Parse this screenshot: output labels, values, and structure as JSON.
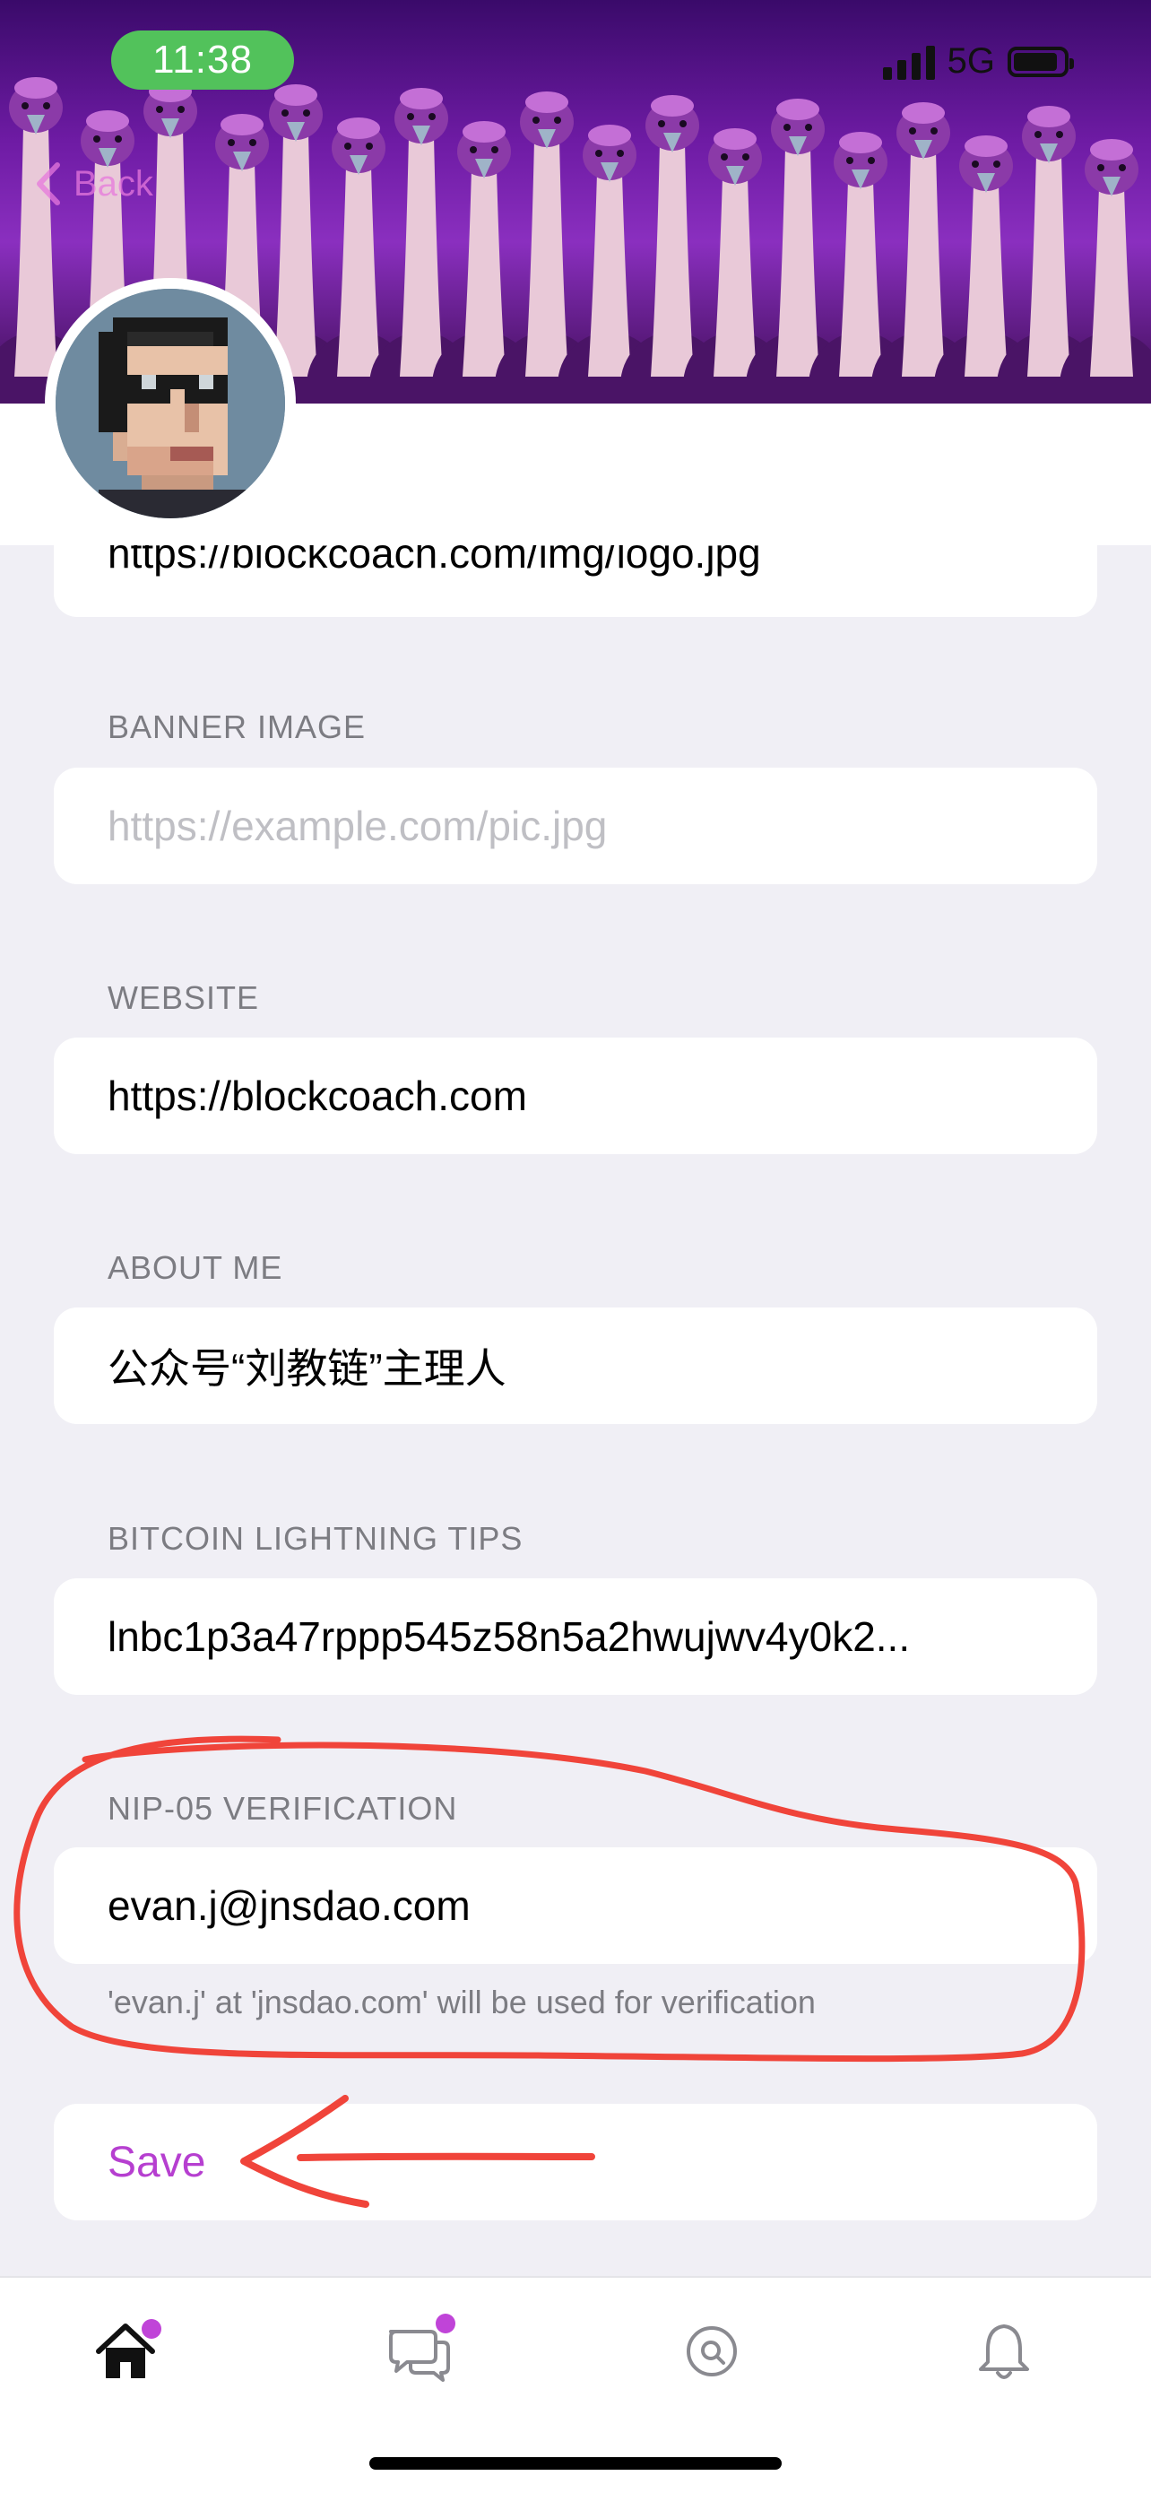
{
  "status_bar": {
    "time": "11:38",
    "network": "5G",
    "battery_level": 0.8
  },
  "nav": {
    "back_label": "Back"
  },
  "fields": {
    "picture_value": "https://blockcoach.com/img/logo.jpg",
    "banner": {
      "label": "BANNER IMAGE",
      "placeholder": "https://example.com/pic.jpg"
    },
    "website": {
      "label": "WEBSITE",
      "value": "https://blockcoach.com"
    },
    "about": {
      "label": "ABOUT ME",
      "value": " 公众号“刘教链”主理人"
    },
    "lightning": {
      "label": "BITCOIN LIGHTNING TIPS",
      "value": "lnbc1p3a47rppp545z58n5a2hwujwv4y0k2..."
    },
    "nip05": {
      "label": "NIP-05 VERIFICATION",
      "value": "evan.j@jnsdao.com",
      "helper": "'evan.j' at 'jnsdao.com' will be used for verification"
    }
  },
  "actions": {
    "save_label": "Save"
  },
  "tabbar": {
    "items": [
      {
        "name": "home",
        "icon": "home-icon",
        "badge": true
      },
      {
        "name": "messages",
        "icon": "chat-bubbles-icon",
        "badge": true
      },
      {
        "name": "search",
        "icon": "search-icon",
        "badge": false
      },
      {
        "name": "notifications",
        "icon": "bell-icon",
        "badge": false
      }
    ]
  },
  "colors": {
    "accent": "#b63fd0",
    "annotation": "#f0443a",
    "status_pill": "#52c25b",
    "badge": "#c044d8"
  }
}
